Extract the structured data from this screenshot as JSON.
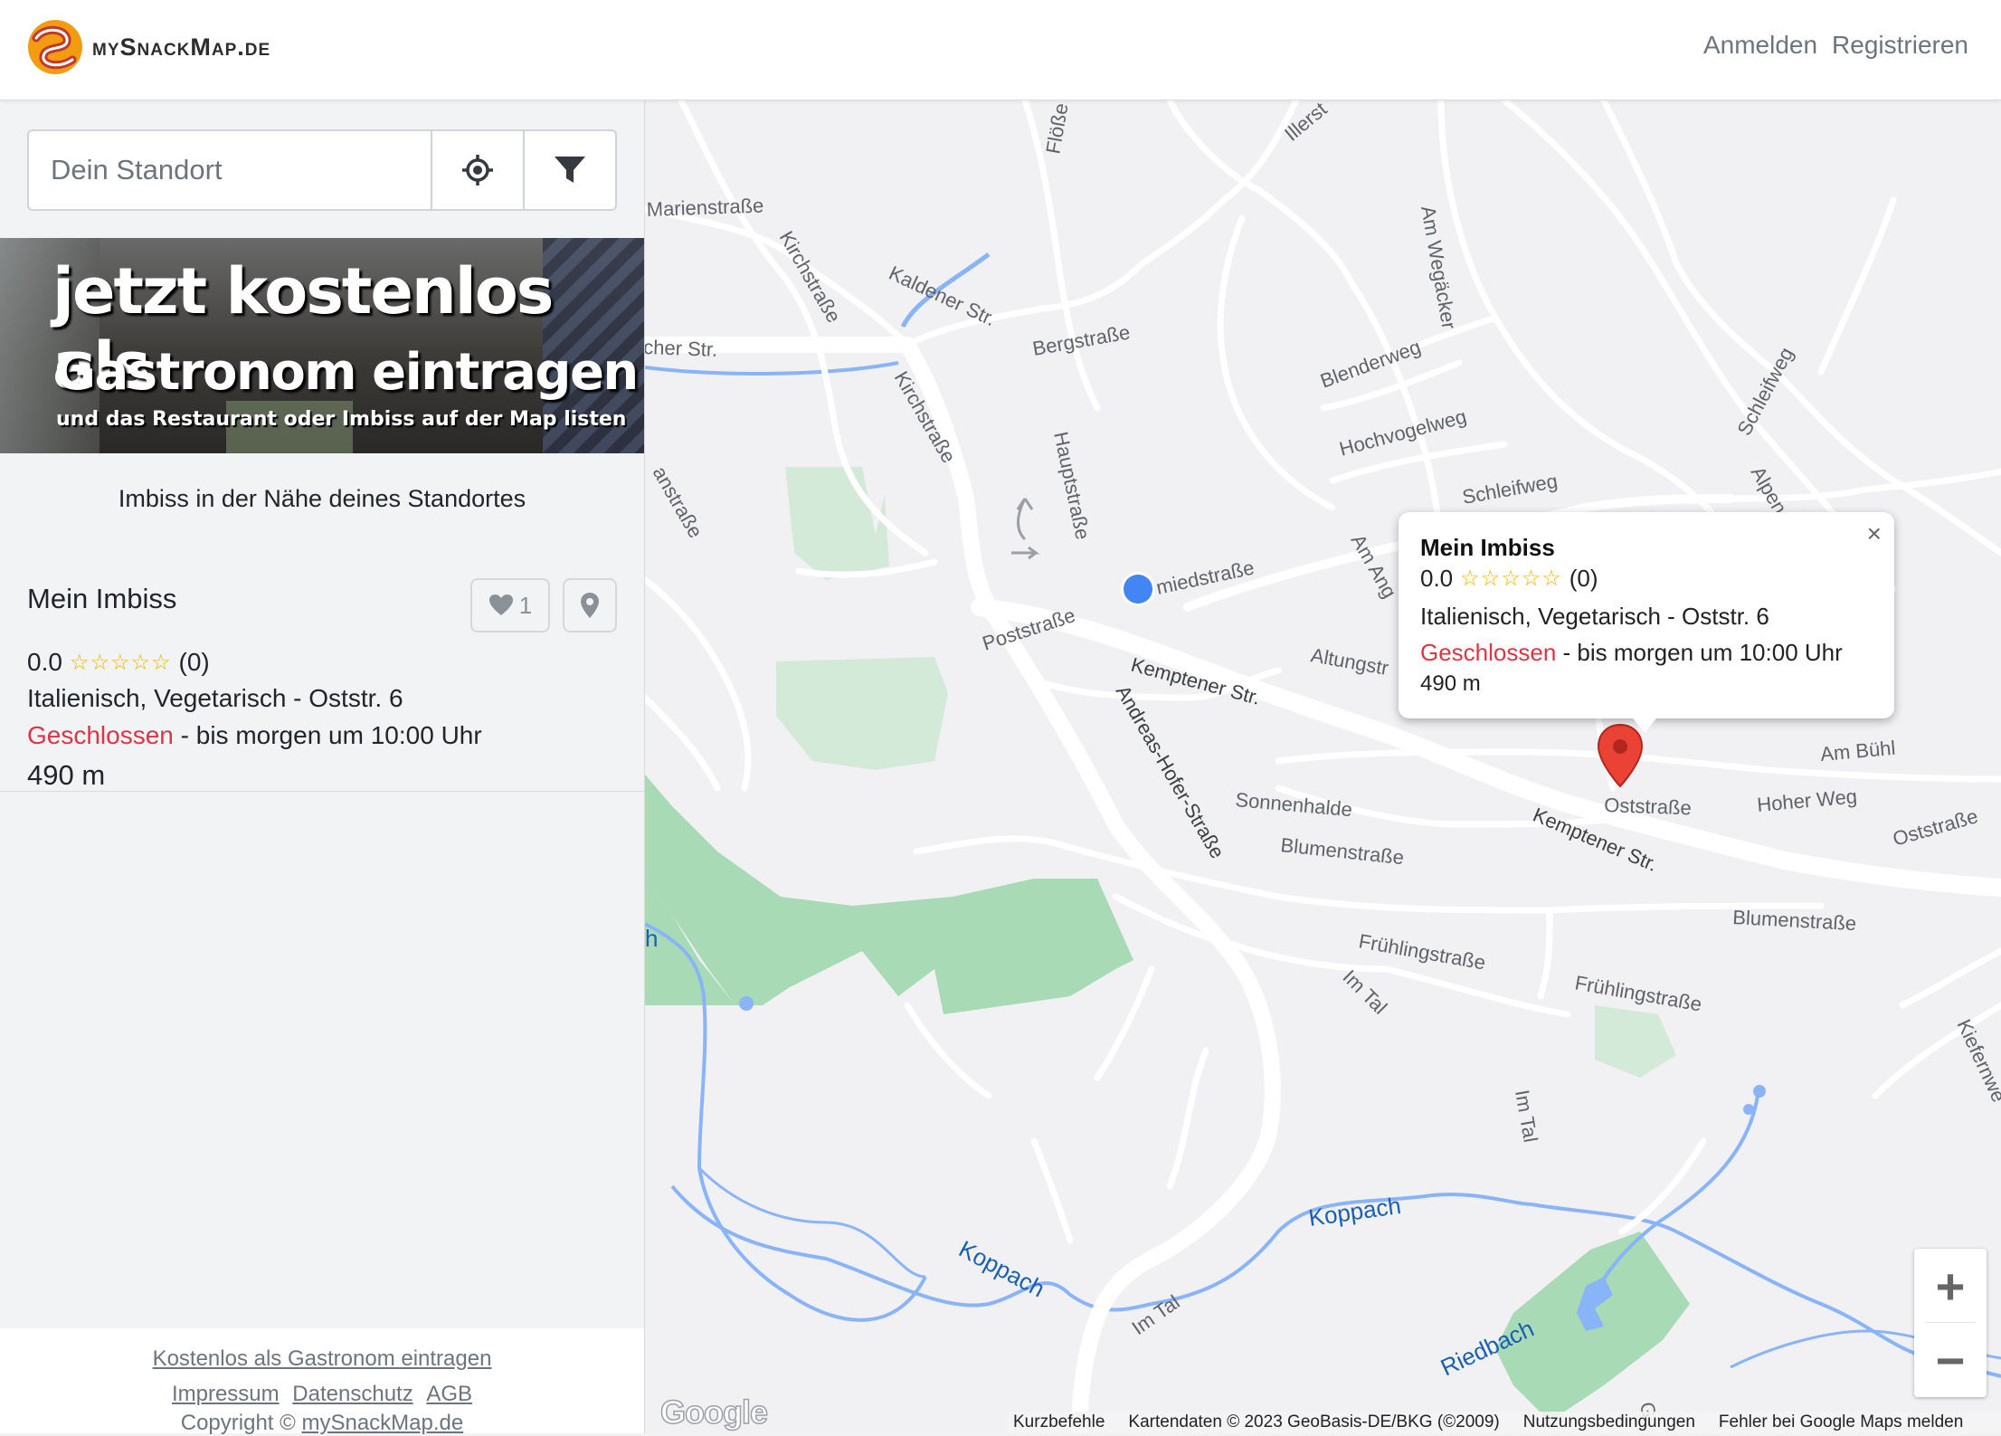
{
  "header": {
    "logo_text": "mySnackMap.de",
    "nav": [
      "Anmelden",
      "Registrieren"
    ]
  },
  "sidebar": {
    "search_placeholder": "Dein Standort",
    "banner": {
      "line1": "jetzt kostenlos als",
      "line2": "Gastronom eintragen",
      "line3": "und das Restaurant oder Imbiss auf der Map listen"
    },
    "section_title": "Imbiss in der Nähe deines Standortes",
    "result": {
      "name": "Mein Imbiss",
      "rating": "0.0",
      "stars": "☆☆☆☆☆",
      "reviews": "(0)",
      "cuisine": "Italienisch, Vegetarisch - Oststr. 6",
      "status_closed": "Geschlossen",
      "status_rest": " - bis morgen um 10:00 Uhr",
      "distance": "490 m",
      "favorites": "1"
    },
    "footer": {
      "register_link": "Kostenlos als Gastronom eintragen",
      "links": [
        "Impressum",
        "Datenschutz",
        "AGB"
      ],
      "copyright": "Copyright © ",
      "copyright_link": "mySnackMap.de"
    }
  },
  "map": {
    "streets": [
      "Marienstraße",
      "Kirchstraße",
      "Kaldener Str.",
      "Flöße",
      "Illerst",
      "Am Wegäcker",
      "Bergstraße",
      "Blenderweg",
      "Hochvogelweg",
      "Schleifweg",
      "Schleifweg",
      "Alpen",
      "Hauptstraße",
      "Kirchstraße",
      "anstraße",
      "cher Str.",
      "Poststraße",
      "miedstraße",
      "Am Ang",
      "Kemptener Str.",
      "Altungstr",
      "Andreas-Hofer-Straße",
      "Sonnenhalde",
      "Blumenstraße",
      "Oststraße",
      "Hoher Weg",
      "Am Bühl",
      "Oststraße",
      "Kemptener Str.",
      "Blumenstraße",
      "Frühlingstraße",
      "Frühlingstraße",
      "Im Tal",
      "Im Tal",
      "Kiefernwe",
      "Koppach",
      "Koppach",
      "Im Tal",
      "Riedbach",
      "h",
      "G"
    ],
    "popup": {
      "name": "Mein Imbiss",
      "rating": "0.0",
      "stars": "☆☆☆☆☆",
      "reviews": "(0)",
      "cuisine": "Italienisch, Vegetarisch - Oststr. 6",
      "status_closed": "Geschlossen",
      "status_rest": " - bis morgen um 10:00 Uhr",
      "distance": "490 m",
      "close": "×"
    },
    "zoom_in": "+",
    "zoom_out": "−",
    "google_logo": "Google",
    "attribution": [
      "Kurzbefehle",
      "Kartendaten © 2023 GeoBasis-DE/BKG (©2009)",
      "Nutzungsbedingungen",
      "Fehler bei Google Maps melden"
    ]
  },
  "colors": {
    "closed": "#dc3545",
    "star": "#f0b400",
    "marker": "#ea4335",
    "location_dot": "#4285f4",
    "park": "#a8dab5",
    "water": "#8ab4f8"
  }
}
